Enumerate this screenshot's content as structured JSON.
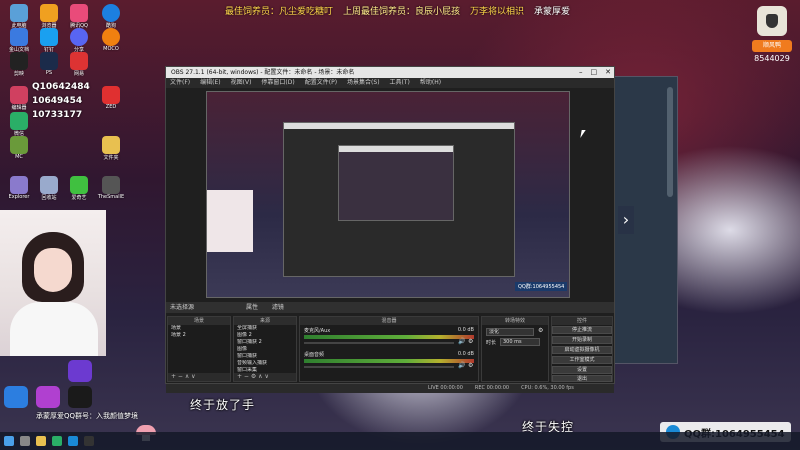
{
  "banner": {
    "items": [
      "最佳饲养员：凡尘爱吃糖叮",
      "上周最佳饲养员：良辰小屁孩",
      "万李将以相识",
      "承蒙厚爱"
    ]
  },
  "right_widget": {
    "button": "顺风鸭",
    "number": "8544029"
  },
  "desktop": {
    "qq_lines": [
      "Q10642484",
      "10649454",
      "10733177"
    ],
    "icon_labels": [
      "此电脑",
      "浏览器",
      "腾讯QQ",
      "酷狗",
      "金山文档",
      "钉钉",
      "分享",
      "MOCO",
      "剪映",
      "PS",
      "网易",
      "编辑器",
      "ZED",
      "微信",
      "MC",
      "Explorer",
      "文件夹",
      "回收站",
      "爱奇艺",
      "剪辑",
      "工具",
      "TheSmallE"
    ],
    "colors": {
      "qq_blue": "#1a8ad6",
      "orange": "#f07b1e",
      "banner_yellow": "#ffd84a"
    }
  },
  "bottom_marquee": "承蒙厚爱QQ群号：入我颜值梦境",
  "subtitles": {
    "left": "终于放了手",
    "right": "终于失控"
  },
  "qq_group": {
    "label": "QQ群:1064955454"
  },
  "obs": {
    "title": "OBS 27.1.1 (64-bit, windows) - 配置文件：未命名 - 场景：未命名",
    "menu": [
      "文件(F)",
      "编辑(E)",
      "视图(V)",
      "停靠窗口(D)",
      "配置文件(P)",
      "场景集合(S)",
      "工具(T)",
      "帮助(H)"
    ],
    "source_strip": "未选择源",
    "source_strip_buttons": [
      "属性",
      "滤镜"
    ],
    "panels": {
      "scenes": {
        "title": "场景",
        "items": [
          "场景",
          "场景 2"
        ]
      },
      "sources": {
        "title": "来源",
        "items": [
          "全屏捕获",
          "图像 2",
          "窗口捕获 2",
          "图像",
          "窗口捕获",
          "音频输入捕获",
          "窗口采集"
        ]
      },
      "mixer": {
        "title": "混音器",
        "channels": [
          {
            "name": "麦克风/Aux",
            "db": "0.0 dB"
          },
          {
            "name": "桌面音频",
            "db": "0.0 dB"
          }
        ]
      },
      "transitions": {
        "title": "转场特效",
        "type": "淡化",
        "duration_label": "时长",
        "duration": "300 ms"
      },
      "controls": {
        "title": "控件",
        "buttons": [
          "停止推流",
          "开始录制",
          "启动虚拟摄像机",
          "工作室模式",
          "设置",
          "退出"
        ]
      }
    },
    "status": {
      "live": "LIVE 00:00:00",
      "rec": "REC 00:00:00",
      "cpu": "CPU: 0.6%, 30.00 fps"
    },
    "preview_badge": "QQ群:1064955454"
  }
}
